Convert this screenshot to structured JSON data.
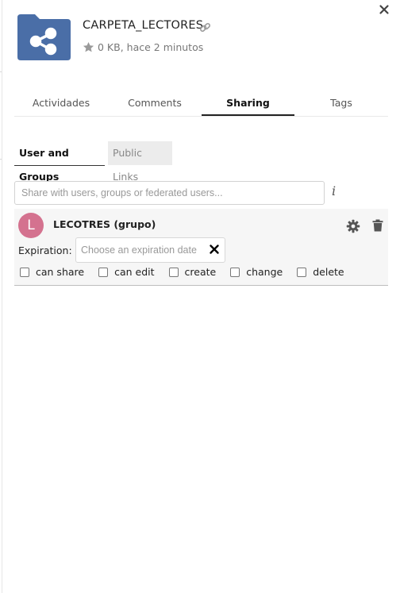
{
  "header": {
    "folder_name": "CARPETA_LECTORES",
    "meta_text": "0 KB, hace 2 minutos"
  },
  "tabs": [
    {
      "label": "Actividades",
      "active": false
    },
    {
      "label": "Comments",
      "active": false
    },
    {
      "label": "Sharing",
      "active": true
    },
    {
      "label": "Tags",
      "active": false
    }
  ],
  "subtabs": {
    "users_groups": "User and Groups",
    "public_links": "Public Links"
  },
  "share": {
    "placeholder": "Share with users, groups or federated users...",
    "value": ""
  },
  "share_entry": {
    "avatar_letter": "L",
    "avatar_color": "#d4728f",
    "name": "LECOTRES (grupo)",
    "expiration_label": "Expiration:",
    "expiration_placeholder": "Choose an expiration date",
    "expiration_value": "",
    "permissions": [
      {
        "label": "can share",
        "checked": false
      },
      {
        "label": "can edit",
        "checked": false
      },
      {
        "label": "create",
        "checked": false
      },
      {
        "label": "change",
        "checked": false
      },
      {
        "label": "delete",
        "checked": false
      }
    ]
  },
  "colors": {
    "folder_blue": "#4a6ea7",
    "tab_underline": "#222222"
  },
  "icons": {
    "folder": "share-folder-icon",
    "link": "link-icon",
    "star": "star-icon",
    "info": "info-icon",
    "gear": "gear-icon",
    "trash": "trash-icon",
    "clear": "close-icon"
  }
}
